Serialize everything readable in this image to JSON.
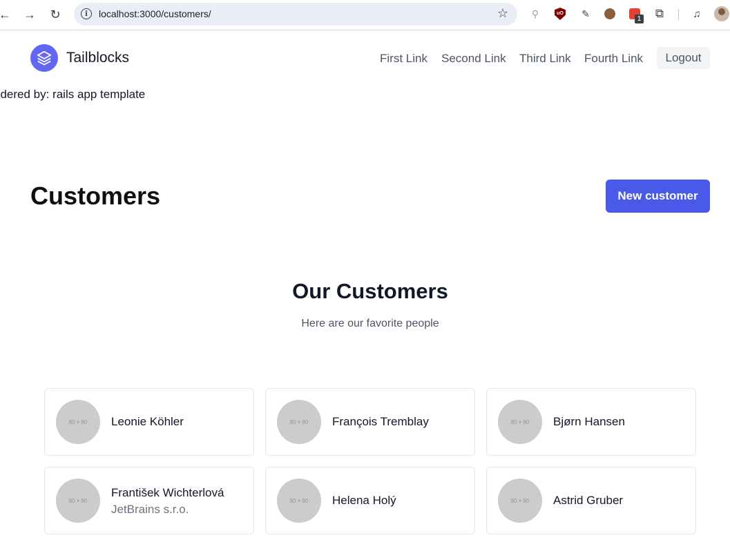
{
  "browser": {
    "url": "localhost:3000/customers/",
    "badge_count": "1"
  },
  "header": {
    "brand": "Tailblocks",
    "nav": [
      "First Link",
      "Second Link",
      "Third Link",
      "Fourth Link"
    ],
    "logout_label": "Logout",
    "logo_color": "#6366f1"
  },
  "rendered_by": "ndered by: rails app template",
  "page": {
    "title": "Customers",
    "new_button_label": "New customer",
    "accent_color": "#4a5ae8"
  },
  "section": {
    "title": "Our Customers",
    "subtitle": "Here are our favorite people"
  },
  "customers": [
    {
      "avatar": "80 × 80",
      "name": "Leonie Köhler",
      "company": ""
    },
    {
      "avatar": "80 × 80",
      "name": "François Tremblay",
      "company": ""
    },
    {
      "avatar": "80 × 80",
      "name": "Bjørn Hansen",
      "company": ""
    },
    {
      "avatar": "80 × 80",
      "name": "František Wichterlová",
      "company": "JetBrains s.r.o."
    },
    {
      "avatar": "80 × 80",
      "name": "Helena Holý",
      "company": ""
    },
    {
      "avatar": "80 × 80",
      "name": "Astrid Gruber",
      "company": ""
    }
  ]
}
